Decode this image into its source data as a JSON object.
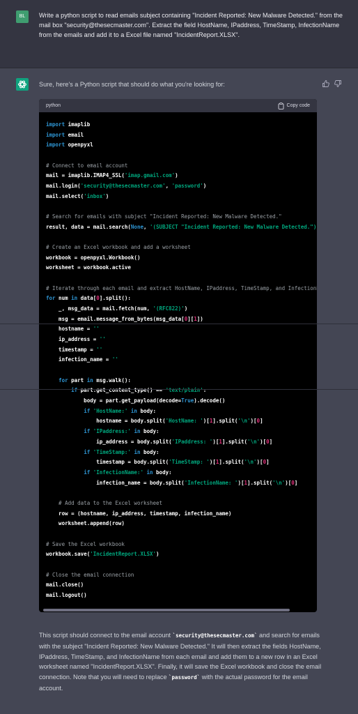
{
  "user_message": {
    "avatar_initials": "BL",
    "text": "Write a python script to read emails subject containing \"Incident Reported: New Malware Detected.\" from the mail box \"security@thesecmaster.com\". Extract the field HostName, IPaddress, TimeStamp, InfectionName from the emails and add it to a Excel file named \"IncidentReport.XLSX\"."
  },
  "assistant_message": {
    "intro": "Sure, here's a Python script that should do what you're looking for:",
    "code_block": {
      "language": "python",
      "copy_label": "Copy code",
      "lines": [
        [
          [
            "k",
            "import"
          ],
          [
            "p",
            " imaplib"
          ]
        ],
        [
          [
            "k",
            "import"
          ],
          [
            "p",
            " email"
          ]
        ],
        [
          [
            "k",
            "import"
          ],
          [
            "p",
            " openpyxl"
          ]
        ],
        [],
        [
          [
            "c",
            "# Connect to email account"
          ]
        ],
        [
          [
            "p",
            "mail = imaplib.IMAP4_SSL("
          ],
          [
            "s",
            "'imap.gmail.com'"
          ],
          [
            "p",
            ")"
          ]
        ],
        [
          [
            "p",
            "mail.login("
          ],
          [
            "s",
            "'security@thesecmaster.com'"
          ],
          [
            "p",
            ", "
          ],
          [
            "s",
            "'password'"
          ],
          [
            "p",
            ")"
          ]
        ],
        [
          [
            "p",
            "mail.select("
          ],
          [
            "s",
            "'inbox'"
          ],
          [
            "p",
            ")"
          ]
        ],
        [],
        [
          [
            "c",
            "# Search for emails with subject \"Incident Reported: New Malware Detected.\""
          ]
        ],
        [
          [
            "p",
            "result, data = mail.search("
          ],
          [
            "k",
            "None"
          ],
          [
            "p",
            ", "
          ],
          [
            "s",
            "'(SUBJECT \"Incident Reported: New Malware Detected.\")'"
          ],
          [
            "p",
            ")"
          ]
        ],
        [],
        [
          [
            "c",
            "# Create an Excel workbook and add a worksheet"
          ]
        ],
        [
          [
            "p",
            "workbook = openpyxl.Workbook()"
          ]
        ],
        [
          [
            "p",
            "worksheet = workbook.active"
          ]
        ],
        [],
        [
          [
            "c",
            "# Iterate through each email and extract HostName, IPaddress, TimeStamp, and InfectionName"
          ]
        ],
        [
          [
            "k",
            "for"
          ],
          [
            "p",
            " num "
          ],
          [
            "k",
            "in"
          ],
          [
            "p",
            " data["
          ],
          [
            "n",
            "0"
          ],
          [
            "p",
            "].split():"
          ]
        ],
        [
          [
            "p",
            "    _, msg_data = mail.fetch(num, "
          ],
          [
            "s",
            "'(RFC822)'"
          ],
          [
            "p",
            ")"
          ]
        ],
        [
          [
            "p",
            "    msg = email.message_from_bytes(msg_data["
          ],
          [
            "n",
            "0"
          ],
          [
            "p",
            "]["
          ],
          [
            "n",
            "1"
          ],
          [
            "p",
            "])"
          ]
        ],
        [
          [
            "p",
            "    hostname = "
          ],
          [
            "s",
            "''"
          ]
        ],
        [
          [
            "p",
            "    ip_address = "
          ],
          [
            "s",
            "''"
          ]
        ],
        [
          [
            "p",
            "    timestamp = "
          ],
          [
            "s",
            "''"
          ]
        ],
        [
          [
            "p",
            "    infection_name = "
          ],
          [
            "s",
            "''"
          ]
        ],
        [],
        [
          [
            "p",
            "    "
          ],
          [
            "k",
            "for"
          ],
          [
            "p",
            " part "
          ],
          [
            "k",
            "in"
          ],
          [
            "p",
            " msg.walk():"
          ]
        ],
        [
          [
            "p",
            "        "
          ],
          [
            "k",
            "if"
          ],
          [
            "p",
            " part.get_content_type() == "
          ],
          [
            "s",
            "'text/plain'"
          ],
          [
            "p",
            ":"
          ]
        ],
        [
          [
            "p",
            "            body = part.get_payload(decode="
          ],
          [
            "k",
            "True"
          ],
          [
            "p",
            ").decode()"
          ]
        ],
        [
          [
            "p",
            "            "
          ],
          [
            "k",
            "if"
          ],
          [
            "p",
            " "
          ],
          [
            "s",
            "'HostName:'"
          ],
          [
            "p",
            " "
          ],
          [
            "k",
            "in"
          ],
          [
            "p",
            " body:"
          ]
        ],
        [
          [
            "p",
            "                hostname = body.split("
          ],
          [
            "s",
            "'HostName: '"
          ],
          [
            "p",
            ")["
          ],
          [
            "n",
            "1"
          ],
          [
            "p",
            "].split("
          ],
          [
            "s",
            "'\\n'"
          ],
          [
            "p",
            ")["
          ],
          [
            "n",
            "0"
          ],
          [
            "p",
            "]"
          ]
        ],
        [
          [
            "p",
            "            "
          ],
          [
            "k",
            "if"
          ],
          [
            "p",
            " "
          ],
          [
            "s",
            "'IPaddress:'"
          ],
          [
            "p",
            " "
          ],
          [
            "k",
            "in"
          ],
          [
            "p",
            " body:"
          ]
        ],
        [
          [
            "p",
            "                ip_address = body.split("
          ],
          [
            "s",
            "'IPaddress: '"
          ],
          [
            "p",
            ")["
          ],
          [
            "n",
            "1"
          ],
          [
            "p",
            "].split("
          ],
          [
            "s",
            "'\\n'"
          ],
          [
            "p",
            ")["
          ],
          [
            "n",
            "0"
          ],
          [
            "p",
            "]"
          ]
        ],
        [
          [
            "p",
            "            "
          ],
          [
            "k",
            "if"
          ],
          [
            "p",
            " "
          ],
          [
            "s",
            "'TimeStamp:'"
          ],
          [
            "p",
            " "
          ],
          [
            "k",
            "in"
          ],
          [
            "p",
            " body:"
          ]
        ],
        [
          [
            "p",
            "                timestamp = body.split("
          ],
          [
            "s",
            "'TimeStamp: '"
          ],
          [
            "p",
            ")["
          ],
          [
            "n",
            "1"
          ],
          [
            "p",
            "].split("
          ],
          [
            "s",
            "'\\n'"
          ],
          [
            "p",
            ")["
          ],
          [
            "n",
            "0"
          ],
          [
            "p",
            "]"
          ]
        ],
        [
          [
            "p",
            "            "
          ],
          [
            "k",
            "if"
          ],
          [
            "p",
            " "
          ],
          [
            "s",
            "'InfectionName:'"
          ],
          [
            "p",
            " "
          ],
          [
            "k",
            "in"
          ],
          [
            "p",
            " body:"
          ]
        ],
        [
          [
            "p",
            "                infection_name = body.split("
          ],
          [
            "s",
            "'InfectionName: '"
          ],
          [
            "p",
            ")["
          ],
          [
            "n",
            "1"
          ],
          [
            "p",
            "].split("
          ],
          [
            "s",
            "'\\n'"
          ],
          [
            "p",
            ")["
          ],
          [
            "n",
            "0"
          ],
          [
            "p",
            "]"
          ]
        ],
        [],
        [
          [
            "c",
            "    # Add data to the Excel worksheet"
          ]
        ],
        [
          [
            "p",
            "    row = (hostname, ip_address, timestamp, infection_name)"
          ]
        ],
        [
          [
            "p",
            "    worksheet.append(row)"
          ]
        ],
        [],
        [
          [
            "c",
            "# Save the Excel workbook"
          ]
        ],
        [
          [
            "p",
            "workbook.save("
          ],
          [
            "s",
            "'IncidentReport.XLSX'"
          ],
          [
            "p",
            ")"
          ]
        ],
        [],
        [
          [
            "c",
            "# Close the email connection"
          ]
        ],
        [
          [
            "p",
            "mail.close()"
          ]
        ],
        [
          [
            "p",
            "mail.logout()"
          ]
        ]
      ]
    },
    "outro": [
      [
        "t",
        "This script should connect to the email account "
      ],
      [
        "code",
        "`security@thesecmaster.com`"
      ],
      [
        "t",
        " and search for emails with the subject \"Incident Reported: New Malware Detected.\" It will then extract the fields HostName, IPaddress, TimeStamp, and InfectionName from each email and add them to a new row in an Excel worksheet named \"IncidentReport.XLSX\". Finally, it will save the Excel workbook and close the email connection. Note that you will need to replace "
      ],
      [
        "code",
        "`password`"
      ],
      [
        "t",
        " with the actual password for the email account."
      ]
    ]
  },
  "icons": {
    "assistant_avatar": "openai-logo-icon",
    "thumbs_up": "thumbs-up-icon",
    "thumbs_down": "thumbs-down-icon",
    "copy": "clipboard-icon"
  },
  "colors": {
    "user_bg": "#343541",
    "assistant_bg": "#444654",
    "code_bg": "#000000",
    "keyword": "#2e95d3",
    "string": "#00a67d",
    "number": "#df3079",
    "comment": "#9aa0a6",
    "user_avatar": "#3f9d70",
    "assistant_avatar": "#10a37f"
  }
}
